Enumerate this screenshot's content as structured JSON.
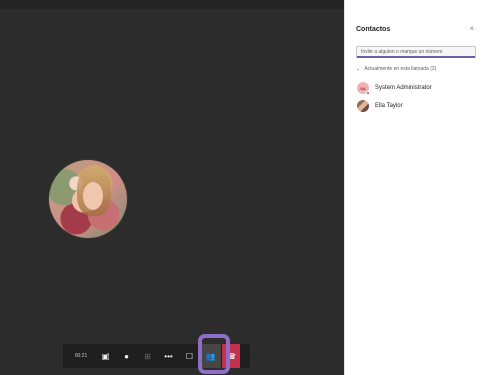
{
  "call": {
    "duration": "00:21",
    "toolbar": {
      "camera_icon": "camera-off-icon",
      "mic_icon": "microphone-icon",
      "share_icon": "share-screen-icon",
      "more_icon": "more-options-icon",
      "chat_icon": "chat-icon",
      "participants_icon": "participants-icon",
      "hangup_icon": "hang-up-icon"
    }
  },
  "sidebar": {
    "title": "Contactos",
    "close_icon": "close-icon",
    "search": {
      "placeholder": "Invite a alguien o marque un número"
    },
    "section_label": "Actualmente en esta llamada (2)",
    "participants": [
      {
        "initials": "SA",
        "name": "System Administrator"
      },
      {
        "initials": "",
        "name": "Ella Taylor"
      }
    ]
  },
  "colors": {
    "stage_bg": "#2d2c2c",
    "toolbar_bg": "#201f1f",
    "accent": "#6264a7",
    "highlight": "#8e6ec8",
    "hangup": "#c4314b"
  }
}
